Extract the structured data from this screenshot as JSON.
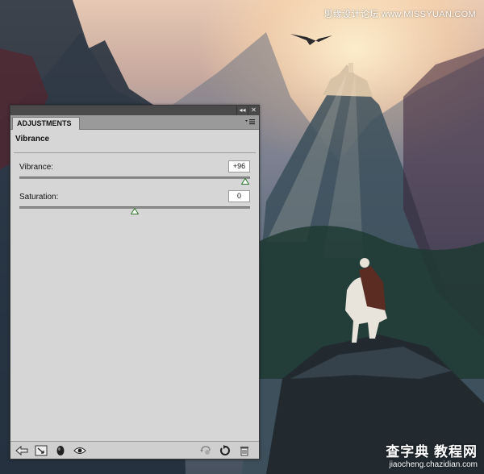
{
  "watermark": {
    "top": "思缘设计论坛 www.MISSYUAN.COM",
    "bottom_title": "查字典 教程网",
    "bottom_url": "jiaocheng.chazidian.com"
  },
  "panel": {
    "strip_buttons": [
      "◂◂",
      "✕"
    ],
    "tab_label": "ADJUSTMENTS",
    "menu_icon": "panel-menu-icon",
    "adjustment_title": "Vibrance",
    "controls": [
      {
        "label": "Vibrance:",
        "value": "+96",
        "slider_fraction": 0.98
      },
      {
        "label": "Saturation:",
        "value": "0",
        "slider_fraction": 0.5
      }
    ],
    "footer_icons": [
      "return-to-list-icon",
      "expanded-view-icon",
      "clip-to-layer-icon",
      "visibility-eye-icon",
      "view-previous-state-icon",
      "reset-icon",
      "trash-icon"
    ]
  },
  "colors": {
    "panel_bg": "#d6d6d6",
    "thumb_fill": "#ffffff",
    "thumb_stroke": "#2d7a2d"
  }
}
